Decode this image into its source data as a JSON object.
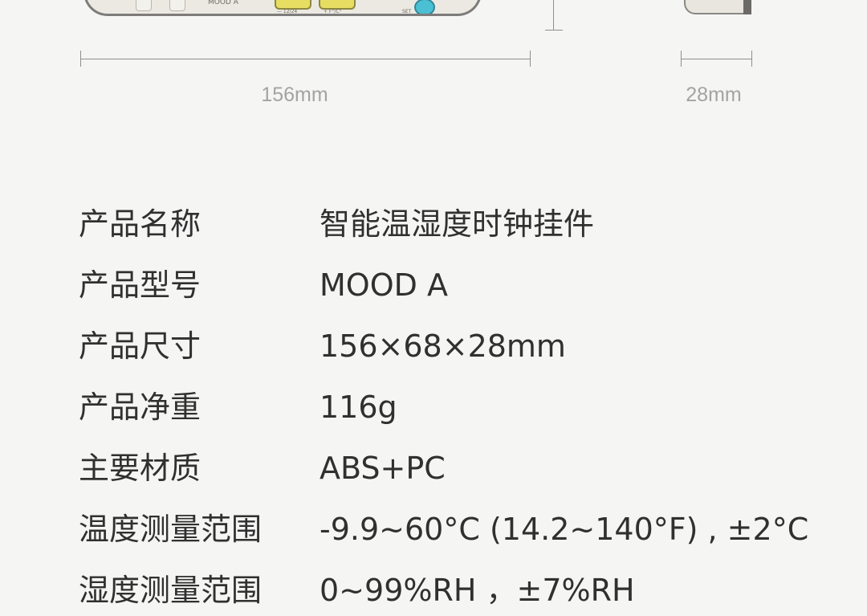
{
  "illustration": {
    "brand_text": "MOOD A",
    "button_labels": [
      "— 12/24",
      "+ F°/C°",
      "SET"
    ]
  },
  "dimensions": {
    "width_label": "156mm",
    "depth_label": "28mm"
  },
  "specs": [
    {
      "label": "产品名称",
      "value": "智能温湿度时钟挂件"
    },
    {
      "label": "产品型号",
      "value": "MOOD A"
    },
    {
      "label": "产品尺寸",
      "value": "156×68×28mm"
    },
    {
      "label": "产品净重",
      "value": "116g"
    },
    {
      "label": "主要材质",
      "value": "ABS+PC"
    },
    {
      "label": "温度测量范围",
      "value": "-9.9~60°C (14.2~140°F) , ±2°C"
    },
    {
      "label": "湿度测量范围",
      "value": "0~99%RH ，±7%RH"
    }
  ]
}
